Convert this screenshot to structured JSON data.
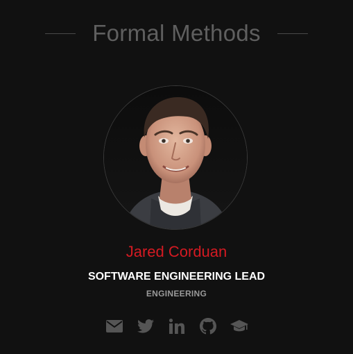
{
  "section": {
    "title": "Formal Methods"
  },
  "member": {
    "name": "Jared Corduan",
    "role": "SOFTWARE ENGINEERING LEAD",
    "department": "ENGINEERING",
    "photo_alt": "Jared Corduan"
  },
  "social_links": [
    {
      "icon": "envelope-icon"
    },
    {
      "icon": "twitter-icon"
    },
    {
      "icon": "linkedin-icon"
    },
    {
      "icon": "github-icon"
    },
    {
      "icon": "graduation-cap-icon"
    }
  ],
  "colors": {
    "background": "#111111",
    "heading": "#5f5f5f",
    "name_accent": "#d41a22",
    "role": "#ffffff",
    "department": "#9a9a9a",
    "icons": "#555555"
  }
}
